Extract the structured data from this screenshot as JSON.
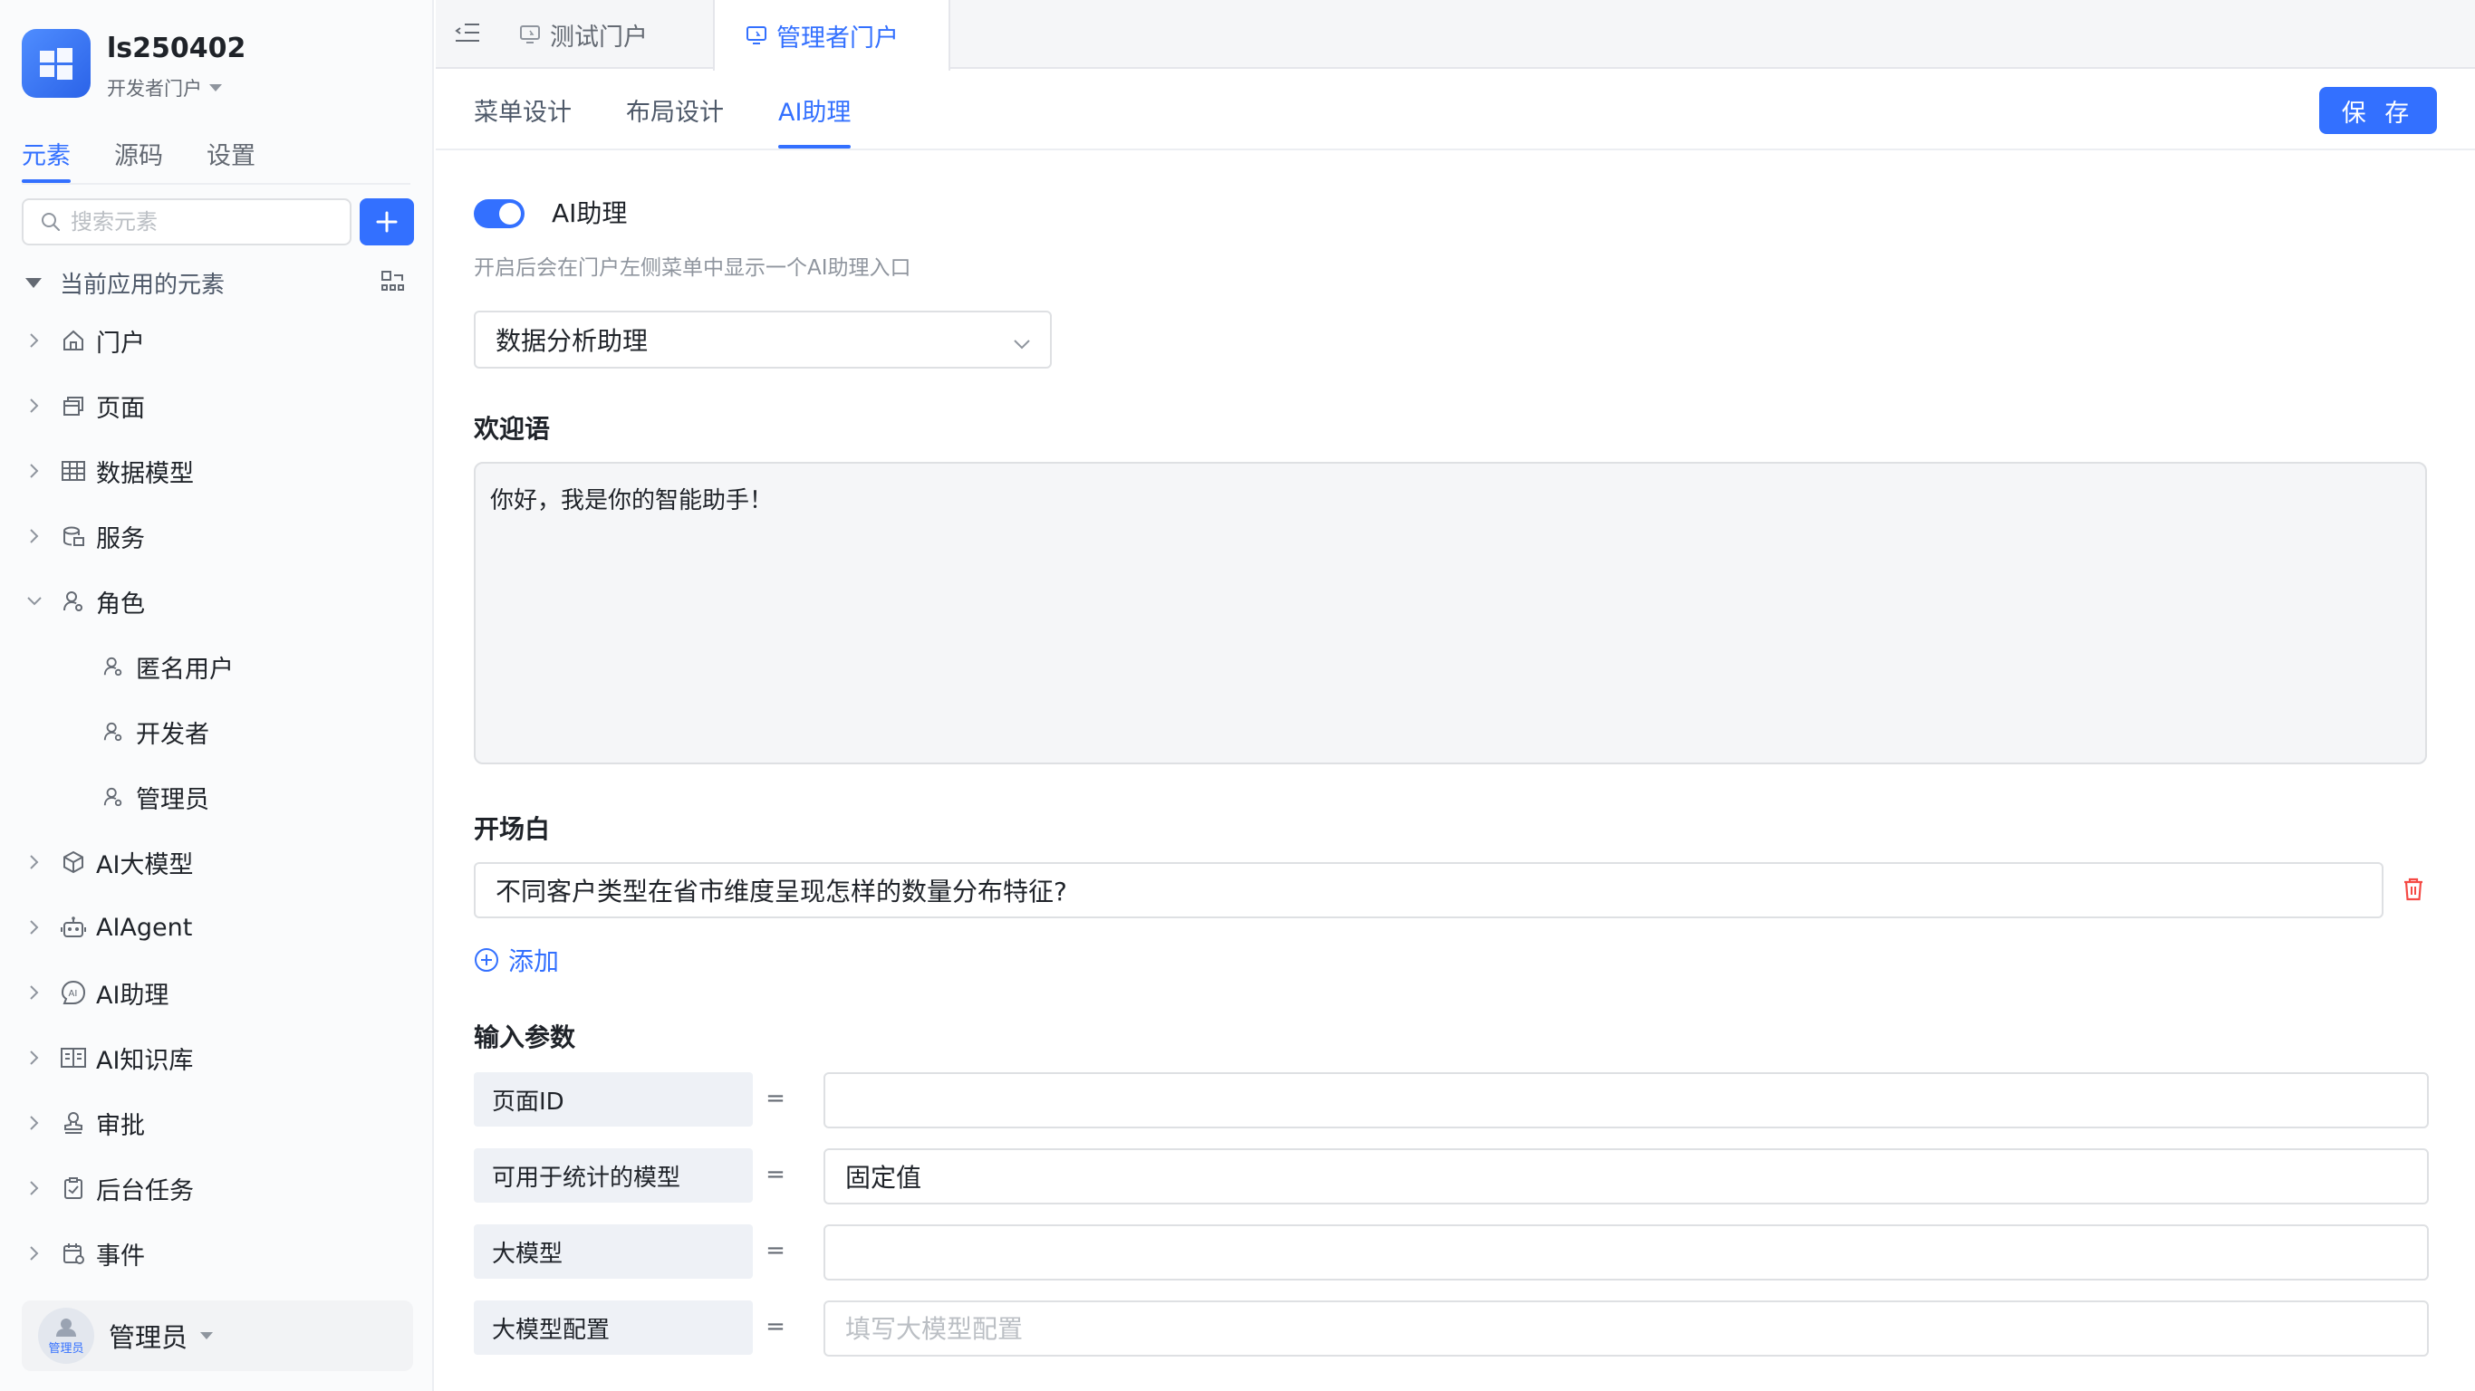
{
  "app": {
    "title": "ls250402",
    "subtitle": "开发者门户"
  },
  "sidebar": {
    "tabs": [
      {
        "label": "元素",
        "active": true
      },
      {
        "label": "源码",
        "active": false
      },
      {
        "label": "设置",
        "active": false
      }
    ],
    "search": {
      "placeholder": "搜索元素",
      "value": ""
    },
    "tree_header": "当前应用的元素",
    "items": [
      {
        "label": "门户",
        "icon": "home-icon",
        "expanded": false
      },
      {
        "label": "页面",
        "icon": "pages-icon",
        "expanded": false
      },
      {
        "label": "数据模型",
        "icon": "table-icon",
        "expanded": false
      },
      {
        "label": "服务",
        "icon": "service-icon",
        "expanded": false
      },
      {
        "label": "角色",
        "icon": "role-icon",
        "expanded": true
      },
      {
        "label": "AI大模型",
        "icon": "cube-icon",
        "expanded": false
      },
      {
        "label": "AIAgent",
        "icon": "robot-icon",
        "expanded": false
      },
      {
        "label": "AI助理",
        "icon": "ai-icon",
        "expanded": false
      },
      {
        "label": "AI知识库",
        "icon": "book-icon",
        "expanded": false
      },
      {
        "label": "审批",
        "icon": "stamp-icon",
        "expanded": false
      },
      {
        "label": "后台任务",
        "icon": "task-icon",
        "expanded": false
      },
      {
        "label": "事件",
        "icon": "event-icon",
        "expanded": false
      }
    ],
    "role_children": [
      "匿名用户",
      "开发者",
      "管理员"
    ],
    "user": {
      "name": "管理员",
      "avatar_text": "管理员"
    }
  },
  "tabs": [
    {
      "label": "测试门户",
      "active": false
    },
    {
      "label": "管理者门户",
      "active": true
    }
  ],
  "subtabs": [
    {
      "label": "菜单设计",
      "active": false
    },
    {
      "label": "布局设计",
      "active": false
    },
    {
      "label": "AI助理",
      "active": true
    }
  ],
  "save_label": "保 存",
  "ai": {
    "toggle_label": "AI助理",
    "toggle_on": true,
    "hint": "开启后会在门户左侧菜单中显示一个AI助理入口",
    "selected_assistant": "数据分析助理",
    "welcome_title": "欢迎语",
    "welcome_text": "你好，我是你的智能助手！",
    "opening_title": "开场白",
    "opening_items": [
      "不同客户类型在省市维度呈现怎样的数量分布特征?"
    ],
    "add_label": "添加",
    "params_title": "输入参数",
    "params": [
      {
        "label": "页面ID",
        "value": "",
        "placeholder": ""
      },
      {
        "label": "可用于统计的模型",
        "value": "固定值",
        "placeholder": ""
      },
      {
        "label": "大模型",
        "value": "",
        "placeholder": ""
      },
      {
        "label": "大模型配置",
        "value": "",
        "placeholder": "填写大模型配置"
      }
    ]
  },
  "colors": {
    "accent": "#3370ff",
    "danger": "#f54a45"
  }
}
